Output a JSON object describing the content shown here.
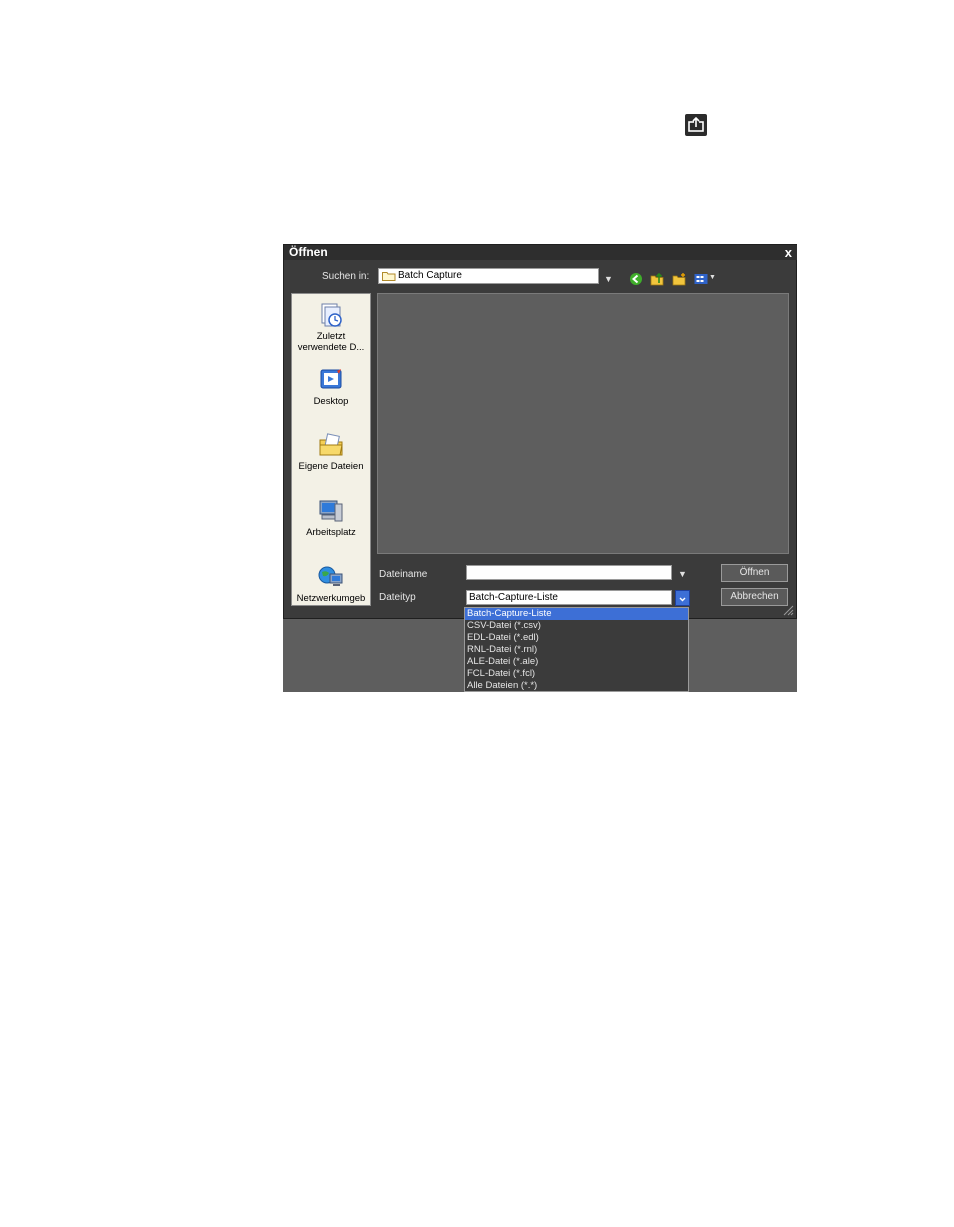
{
  "dialog": {
    "title": "Öffnen",
    "close_label": "x",
    "look_in_label": "Suchen in:",
    "look_in_value": "Batch Capture",
    "places": [
      {
        "label": "Zuletzt verwendete D...",
        "icon": "recent-documents-icon"
      },
      {
        "label": "Desktop",
        "icon": "desktop-icon"
      },
      {
        "label": "Eigene Dateien",
        "icon": "my-documents-icon"
      },
      {
        "label": "Arbeitsplatz",
        "icon": "my-computer-icon"
      },
      {
        "label": "Netzwerkumgeb",
        "icon": "network-icon"
      }
    ],
    "filename_label": "Dateiname",
    "filename_value": "",
    "filetype_label": "Dateityp",
    "filetype_value": "Batch-Capture-Liste",
    "open_button": "Öffnen",
    "cancel_button": "Abbrechen",
    "filetype_options": [
      "Batch-Capture-Liste",
      "CSV-Datei (*.csv)",
      "EDL-Datei (*.edl)",
      "RNL-Datei (*.rnl)",
      "ALE-Datei (*.ale)",
      "FCL-Datei (*.fcl)",
      "Alle Dateien (*.*)"
    ],
    "selected_option_index": 0
  },
  "colors": {
    "selection": "#3d6fd6",
    "dialog_bg": "#3b3b3b",
    "panel_bg": "#5e5e5e",
    "places_bg": "#f3f1e6"
  }
}
